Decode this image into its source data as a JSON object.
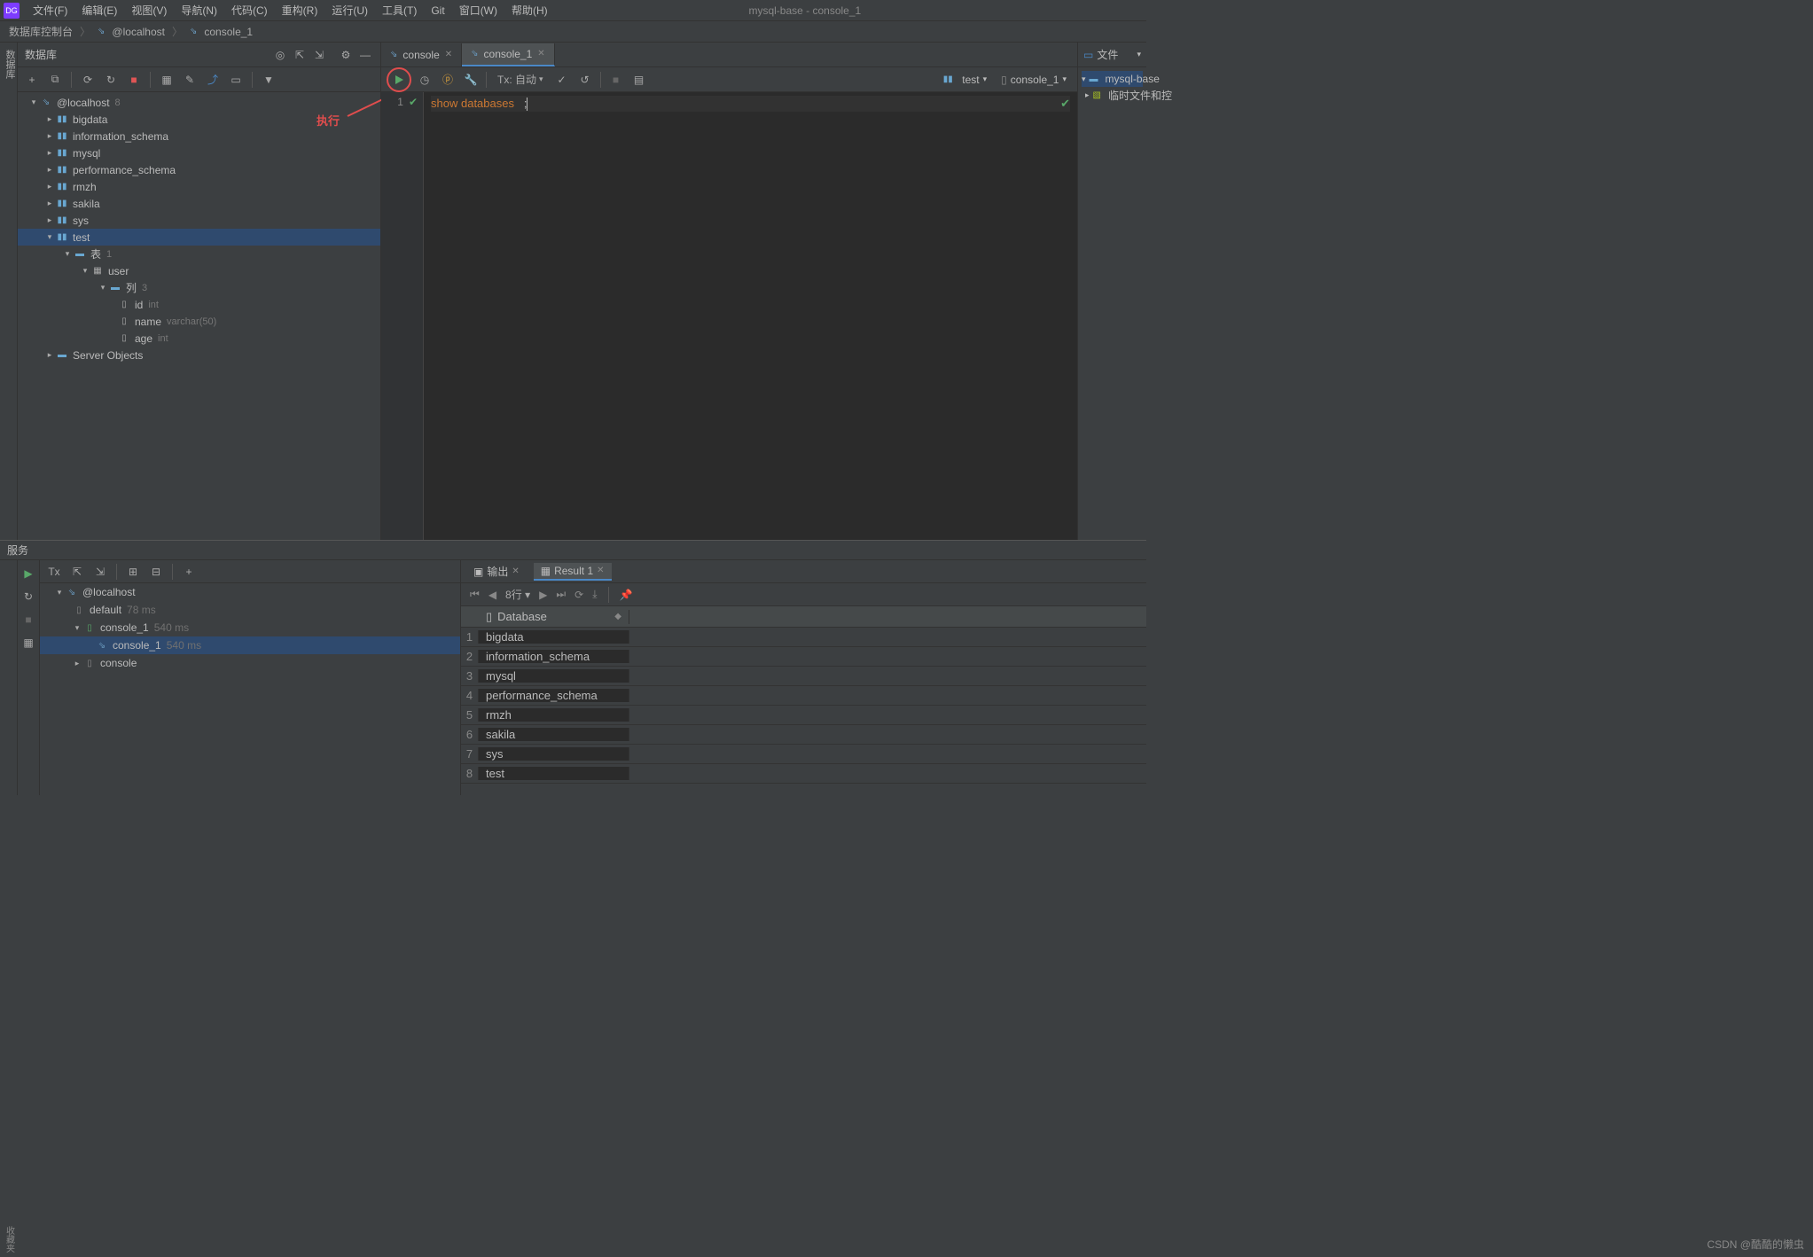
{
  "window_title": "mysql-base - console_1",
  "menu": [
    "文件(F)",
    "编辑(E)",
    "视图(V)",
    "导航(N)",
    "代码(C)",
    "重构(R)",
    "运行(U)",
    "工具(T)",
    "Git",
    "窗口(W)",
    "帮助(H)"
  ],
  "breadcrumb": [
    "数据库控制台",
    "@localhost",
    "console_1"
  ],
  "side_tab": "数据库",
  "side_tab_bottom": "收藏夹",
  "db_panel": {
    "title": "数据库"
  },
  "db_tree": {
    "host": "@localhost",
    "host_count": "8",
    "schemas": [
      "bigdata",
      "information_schema",
      "mysql",
      "performance_schema",
      "rmzh",
      "sakila",
      "sys"
    ],
    "test_schema": "test",
    "tables_label": "表",
    "tables_count": "1",
    "table": "user",
    "columns_label": "列",
    "columns_count": "3",
    "columns": [
      {
        "name": "id",
        "type": "int"
      },
      {
        "name": "name",
        "type": "varchar(50)"
      },
      {
        "name": "age",
        "type": "int"
      }
    ],
    "server_objects": "Server Objects"
  },
  "editor_tabs": [
    {
      "label": "console",
      "active": false
    },
    {
      "label": "console_1",
      "active": true
    }
  ],
  "ed_toolbar": {
    "tx_label": "Tx: 自动",
    "right_schema": "test",
    "right_console": "console_1"
  },
  "annotation_run": "执行",
  "code": {
    "line_no": "1",
    "kw1": "show",
    "kw2": "databases",
    "tail": ";"
  },
  "right_panel": {
    "title": "文件",
    "root": "mysql-base",
    "child": "临时文件和控"
  },
  "services": {
    "title": "服务",
    "tree": {
      "host": "@localhost",
      "default": "default",
      "default_time": "78 ms",
      "console1": "console_1",
      "console1_time": "540 ms",
      "console1_run": "console_1",
      "console1_run_time": "540 ms",
      "console": "console"
    },
    "output_tab": "输出",
    "result_tab": "Result 1",
    "nav_rows": "8行",
    "column": "Database",
    "rows": [
      "bigdata",
      "information_schema",
      "mysql",
      "performance_schema",
      "rmzh",
      "sakila",
      "sys",
      "test"
    ]
  },
  "watermark": "CSDN @酷酷的懒虫"
}
